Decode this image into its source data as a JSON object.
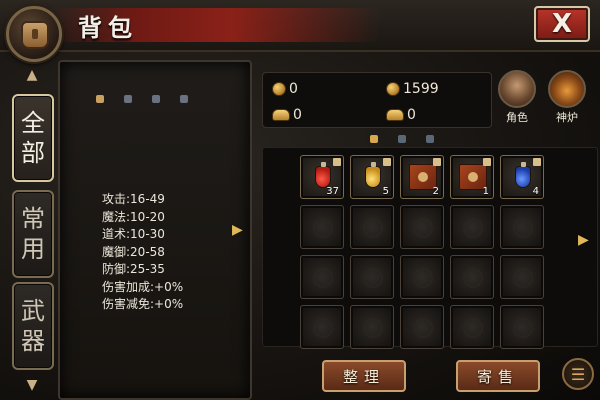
{
  "window": {
    "title": "背包",
    "close_label": "X"
  },
  "tabs": [
    {
      "label_1": "全",
      "label_2": "部",
      "active": true
    },
    {
      "label_1": "常",
      "label_2": "用",
      "active": false
    },
    {
      "label_1": "武",
      "label_2": "器",
      "active": false
    }
  ],
  "stats": {
    "lines": [
      "攻击:16-49",
      "魔法:10-20",
      "道术:10-30",
      "魔御:20-58",
      "防御:25-35",
      "伤害加成:+0%",
      "伤害减免:+0%"
    ]
  },
  "currency": {
    "gold_coin": "0",
    "bound_coin": "1599",
    "gold_ingot": "0",
    "bound_ingot": "0"
  },
  "shortcuts": {
    "character_label": "角色",
    "furnace_label": "神炉"
  },
  "inventory": {
    "items": [
      {
        "slot": 0,
        "icon": "red-potion-icon",
        "count": "37"
      },
      {
        "slot": 1,
        "icon": "gold-potion-icon",
        "count": "5"
      },
      {
        "slot": 2,
        "icon": "skill-book-icon",
        "count": "2"
      },
      {
        "slot": 3,
        "icon": "skill-book-icon",
        "count": "1"
      },
      {
        "slot": 4,
        "icon": "blue-potion-icon",
        "count": "4"
      }
    ]
  },
  "buttons": {
    "sort_label": "整理",
    "consign_label": "寄售"
  },
  "colors": {
    "accent_gold": "#e0b85a",
    "close_red": "#b8352a",
    "button_brown": "#8a4a2a"
  }
}
